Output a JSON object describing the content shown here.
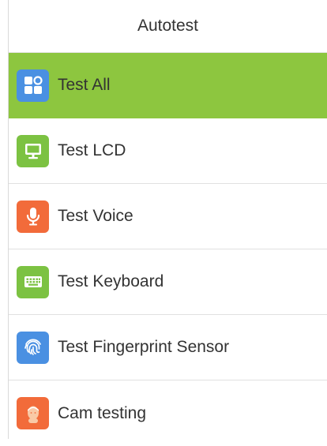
{
  "screen": {
    "title": "Autotest"
  },
  "menu": {
    "items": [
      {
        "label": "Test All",
        "icon": "grid-apps-icon",
        "icon_color": "#4a90e2",
        "selected": true
      },
      {
        "label": "Test LCD",
        "icon": "monitor-icon",
        "icon_color": "#7cc242",
        "selected": false
      },
      {
        "label": "Test Voice",
        "icon": "microphone-icon",
        "icon_color": "#f26b3a",
        "selected": false
      },
      {
        "label": "Test Keyboard",
        "icon": "keyboard-icon",
        "icon_color": "#7cc242",
        "selected": false
      },
      {
        "label": "Test Fingerprint Sensor",
        "icon": "fingerprint-icon",
        "icon_color": "#4a90e2",
        "selected": false
      },
      {
        "label": "Cam testing",
        "icon": "face-camera-icon",
        "icon_color": "#f26b3a",
        "selected": false
      }
    ]
  },
  "colors": {
    "selected_background": "#8dc63f",
    "divider": "#e1e1e1",
    "text": "#333333"
  }
}
